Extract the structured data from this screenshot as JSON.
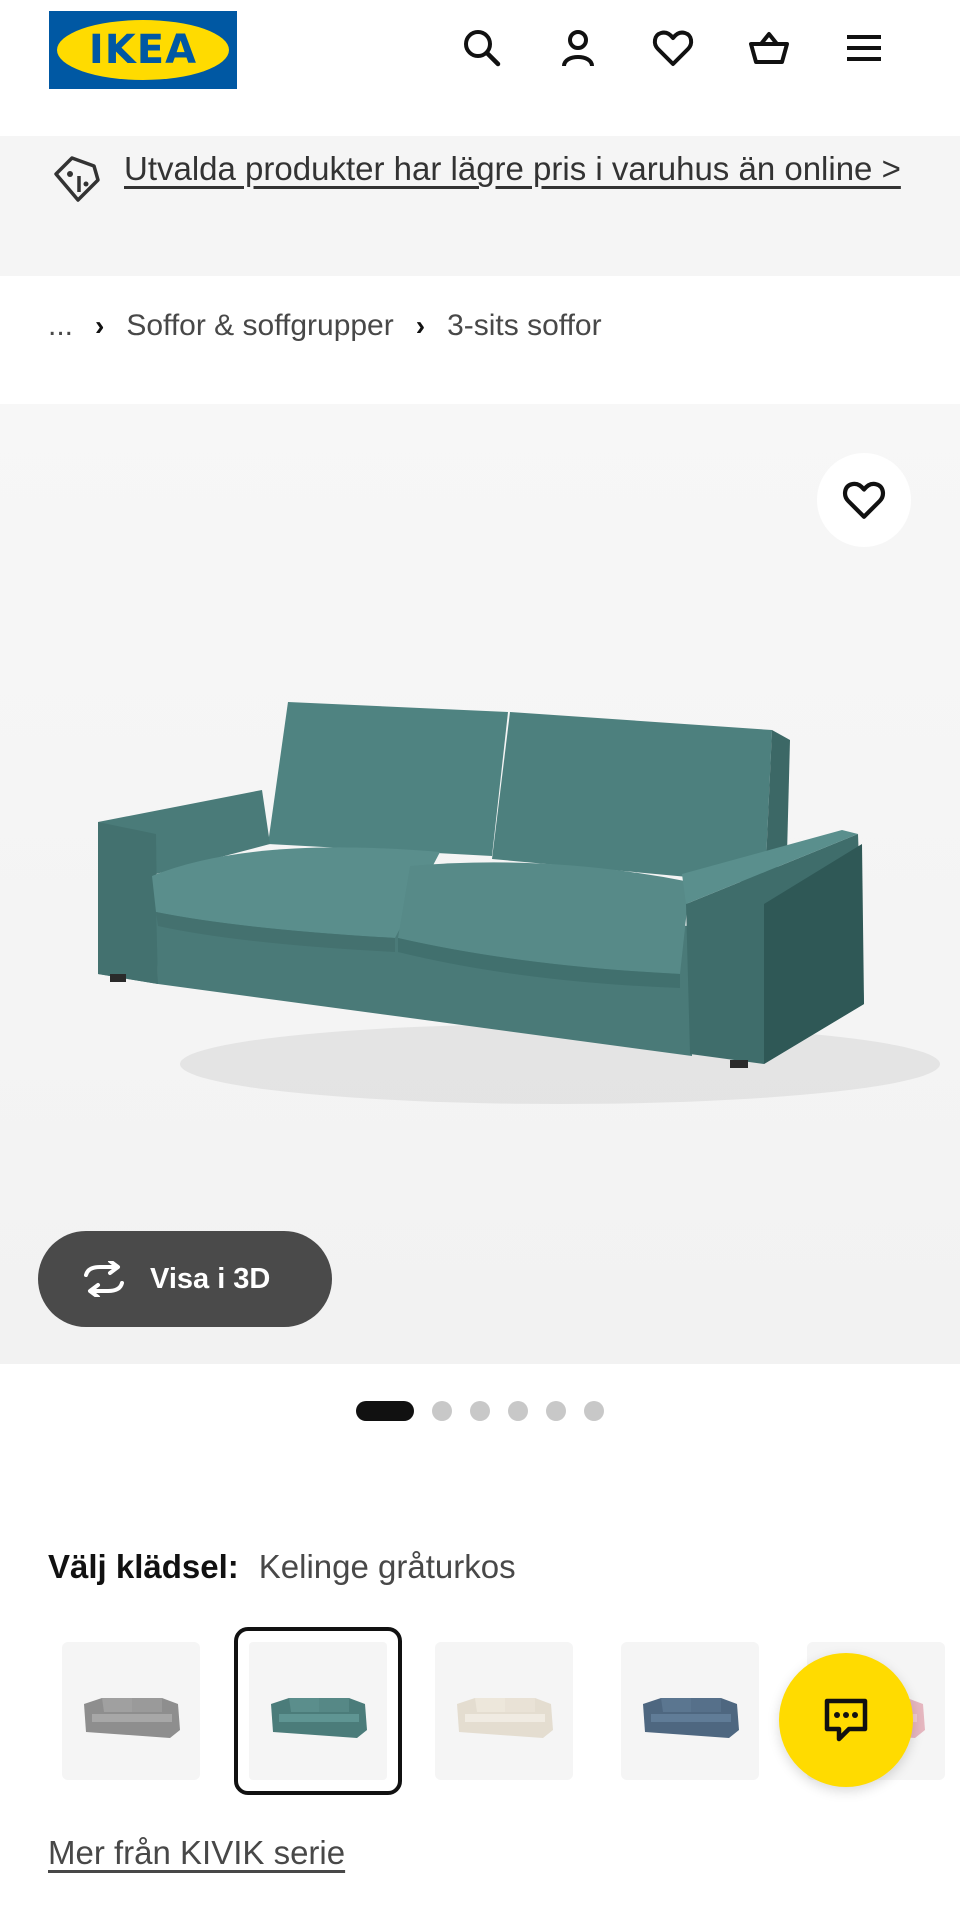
{
  "header": {
    "logo_text": "IKEA",
    "icons": [
      "search-icon",
      "account-icon",
      "heart-icon",
      "basket-icon",
      "menu-icon"
    ]
  },
  "banner": {
    "icon": "price-tag-icon",
    "link_text": "Utvalda produkter har lägre pris i varuhus än online >"
  },
  "breadcrumb": {
    "ellipsis": "...",
    "items": [
      "Soffor & soffgrupper",
      "3-sits soffor"
    ]
  },
  "gallery": {
    "view_3d_label": "Visa i 3D",
    "image_count": 6,
    "active_image": 1
  },
  "upholstery": {
    "label": "Välj klädsel:",
    "selected_value": "Kelinge gråturkos",
    "swatch_colors": [
      "#8e8e8e",
      "#4b7c7a",
      "#e4ddd0",
      "#4e6780",
      "#e6b7c0"
    ],
    "selected_index": 1
  },
  "series_link": "Mer från KIVIK serie",
  "colors": {
    "brand_blue": "#0058a3",
    "brand_yellow": "#ffdb00",
    "sofa_teal": "#4b7c7a"
  }
}
